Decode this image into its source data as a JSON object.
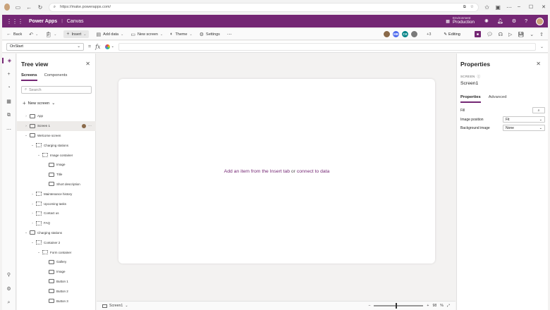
{
  "browser": {
    "url": "https://make.powerapps.com/"
  },
  "app": {
    "title": "Power Apps",
    "subtitle": "Canvas",
    "environment_label": "Environment",
    "environment_name": "Production"
  },
  "toolbar": {
    "back": "Back",
    "insert": "Insert",
    "add_data": "Add data",
    "new_screen": "New screen",
    "theme": "Theme",
    "settings": "Settings",
    "collaborators": [
      {
        "initials": "",
        "color": "#8a6a4a"
      },
      {
        "initials": "MB",
        "color": "#4f6bed"
      },
      {
        "initials": "CK",
        "color": "#038387"
      },
      {
        "initials": "",
        "color": "#7a7a7a"
      }
    ],
    "more_count": "+3",
    "editing": "Editing"
  },
  "formula": {
    "property": "OnStart"
  },
  "tree": {
    "title": "Tree view",
    "tabs": [
      "Screens",
      "Components"
    ],
    "search_placeholder": "Search",
    "new_screen": "New screen",
    "nodes": [
      {
        "label": "App",
        "level": 0,
        "chev": "›",
        "icon": "app"
      },
      {
        "label": "Screen 1",
        "level": 0,
        "chev": "›",
        "icon": "screen",
        "selected": true
      },
      {
        "label": "Welcome screen",
        "level": 0,
        "chev": "⌄",
        "icon": "screen"
      },
      {
        "label": "Charging stations",
        "level": 1,
        "chev": "⌄",
        "icon": "grid"
      },
      {
        "label": "Image container",
        "level": 2,
        "chev": "⌄",
        "icon": "grid"
      },
      {
        "label": "Image",
        "level": 3,
        "chev": "",
        "icon": "image"
      },
      {
        "label": "Title",
        "level": 3,
        "chev": "",
        "icon": "text"
      },
      {
        "label": "Short description",
        "level": 3,
        "chev": "",
        "icon": "text"
      },
      {
        "label": "Maintenance history",
        "level": 1,
        "chev": "›",
        "icon": "grid"
      },
      {
        "label": "Upcoming tasks",
        "level": 1,
        "chev": "›",
        "icon": "grid"
      },
      {
        "label": "Contact us",
        "level": 1,
        "chev": "›",
        "icon": "grid"
      },
      {
        "label": "FAQ",
        "level": 1,
        "chev": "›",
        "icon": "grid"
      },
      {
        "label": "Charging stations",
        "level": 0,
        "chev": "⌄",
        "icon": "screen"
      },
      {
        "label": "Container 2",
        "level": 1,
        "chev": "⌄",
        "icon": "grid"
      },
      {
        "label": "Form container",
        "level": 2,
        "chev": "⌄",
        "icon": "grid"
      },
      {
        "label": "Gallery",
        "level": 3,
        "chev": "",
        "icon": "gallery"
      },
      {
        "label": "Image",
        "level": 3,
        "chev": "",
        "icon": "image"
      },
      {
        "label": "Button 1",
        "level": 3,
        "chev": "",
        "icon": "button"
      },
      {
        "label": "Button 2",
        "level": 3,
        "chev": "",
        "icon": "button"
      },
      {
        "label": "Button 3",
        "level": 3,
        "chev": "",
        "icon": "button"
      }
    ]
  },
  "canvas": {
    "hint_link1": "Add an item from the Insert tab",
    "hint_or": " or ",
    "hint_link2": "connect to data"
  },
  "status": {
    "screen": "Screen1",
    "zoom": "98",
    "zoom_unit": "%",
    "zoom_minus": "−",
    "zoom_plus": "+"
  },
  "properties": {
    "title": "Properties",
    "screen_label": "SCREEN",
    "screen_name": "Screen1",
    "tabs": [
      "Properties",
      "Advanced"
    ],
    "fill_label": "Fill",
    "image_position_label": "Image position",
    "image_position_value": "Fit",
    "background_image_label": "Background image",
    "background_image_value": "None"
  }
}
